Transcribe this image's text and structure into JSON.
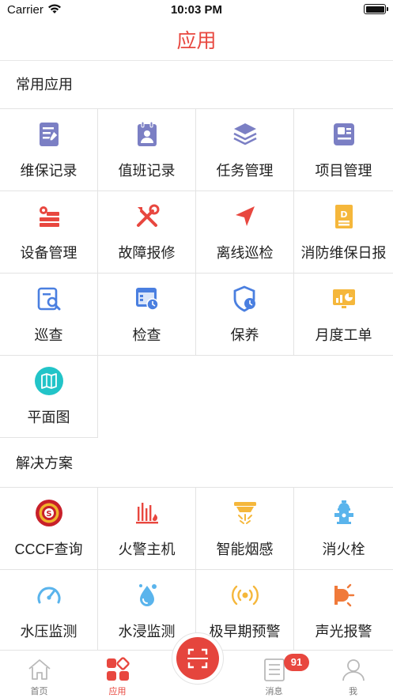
{
  "status_bar": {
    "carrier": "Carrier",
    "time": "10:03 PM"
  },
  "nav": {
    "title": "应用"
  },
  "sections": {
    "common": {
      "title": "常用应用"
    },
    "solutions": {
      "title": "解决方案"
    }
  },
  "common_apps": [
    {
      "label": "维保记录",
      "icon": "maintenance-record-icon",
      "color": "#7b7fc4"
    },
    {
      "label": "值班记录",
      "icon": "duty-record-icon",
      "color": "#7b7fc4"
    },
    {
      "label": "任务管理",
      "icon": "layers-icon",
      "color": "#7b7fc4"
    },
    {
      "label": "项目管理",
      "icon": "project-card-icon",
      "color": "#7b7fc4"
    },
    {
      "label": "设备管理",
      "icon": "device-gear-icon",
      "color": "#e8473f"
    },
    {
      "label": "故障报修",
      "icon": "tools-icon",
      "color": "#e8473f"
    },
    {
      "label": "离线巡检",
      "icon": "navigation-arrow-icon",
      "color": "#e8473f"
    },
    {
      "label": "消防维保日报",
      "icon": "daily-report-icon",
      "color": "#f5b73b"
    },
    {
      "label": "巡查",
      "icon": "search-document-icon",
      "color": "#4a7fe0"
    },
    {
      "label": "检查",
      "icon": "inspection-window-icon",
      "color": "#4a7fe0"
    },
    {
      "label": "保养",
      "icon": "shield-clock-icon",
      "color": "#4a7fe0"
    },
    {
      "label": "月度工单",
      "icon": "monthly-chart-icon",
      "color": "#f5b73b"
    },
    {
      "label": "平面图",
      "icon": "floor-map-icon",
      "color": "#22c4c8"
    }
  ],
  "solutions_apps": [
    {
      "label": "CCCF查询",
      "icon": "cccf-seal-icon",
      "color": "#c8202a"
    },
    {
      "label": "火警主机",
      "icon": "fire-alarm-host-icon",
      "color": "#e8473f"
    },
    {
      "label": "智能烟感",
      "icon": "smoke-detector-icon",
      "color": "#f5b73b"
    },
    {
      "label": "消火栓",
      "icon": "fire-hydrant-icon",
      "color": "#5ab4ec"
    },
    {
      "label": "水压监测",
      "icon": "pressure-gauge-icon",
      "color": "#5ab4ec"
    },
    {
      "label": "水浸监测",
      "icon": "water-drop-icon",
      "color": "#5ab4ec"
    },
    {
      "label": "极早期预警",
      "icon": "early-warning-icon",
      "color": "#f5b73b"
    },
    {
      "label": "声光报警",
      "icon": "sound-light-alarm-icon",
      "color": "#f07a3a"
    }
  ],
  "tabbar": {
    "items": [
      {
        "label": "首页",
        "icon": "home-icon"
      },
      {
        "label": "应用",
        "icon": "apps-icon"
      },
      {
        "label": "",
        "icon": "scan-icon"
      },
      {
        "label": "消息",
        "icon": "message-list-icon",
        "badge": "91"
      },
      {
        "label": "我",
        "icon": "profile-icon"
      }
    ],
    "active_color": "#e8473f",
    "inactive_color": "#999999"
  }
}
